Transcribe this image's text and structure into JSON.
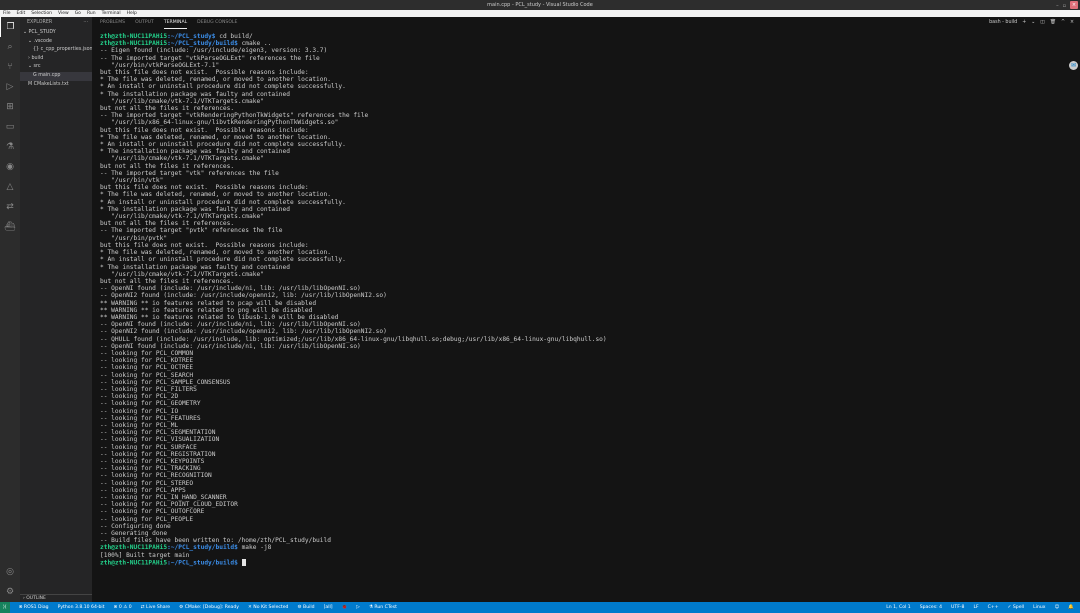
{
  "window": {
    "title": "main.cpp - PCL_study - Visual Studio Code",
    "min": "–",
    "max": "▫",
    "close": "×"
  },
  "menu": [
    "File",
    "Edit",
    "Selection",
    "View",
    "Go",
    "Run",
    "Terminal",
    "Help"
  ],
  "sidebar": {
    "title": "EXPLORER",
    "more": "···",
    "items": [
      {
        "label": "⌄ PCL_STUDY",
        "indent": 0
      },
      {
        "label": "⌄ .vscode",
        "indent": 1
      },
      {
        "label": "{} c_cpp_properties.json",
        "indent": 2
      },
      {
        "label": "› build",
        "indent": 1
      },
      {
        "label": "⌄ src",
        "indent": 1
      },
      {
        "label": "G main.cpp",
        "indent": 2,
        "selected": true
      },
      {
        "label": "M CMakeLists.txt",
        "indent": 1
      }
    ],
    "outline": "› OUTLINE"
  },
  "panel": {
    "tabs": [
      "PROBLEMS",
      "OUTPUT",
      "TERMINAL",
      "DEBUG CONSOLE"
    ],
    "active": 2,
    "controls": {
      "shell": "bash - build",
      "add": "+",
      "dropdown": "⌄",
      "split": "◫",
      "trash": "🗑",
      "maximize": "^",
      "close": "×"
    }
  },
  "terminal": {
    "user": "zth@zth-NUC11PAHi5",
    "lines": [
      {
        "path": ":~/PCL_study$",
        "cmd": " cd build/"
      },
      {
        "path": ":~/PCL_study/build$",
        "cmd": " cmake .."
      },
      "-- Eigen found (include: /usr/include/eigen3, version: 3.3.7)",
      "-- The imported target \"vtkParseOGLExt\" references the file",
      "   \"/usr/bin/vtkParseOGLExt-7.1\"",
      "but this file does not exist.  Possible reasons include:",
      "* The file was deleted, renamed, or moved to another location.",
      "* An install or uninstall procedure did not complete successfully.",
      "* The installation package was faulty and contained",
      "   \"/usr/lib/cmake/vtk-7.1/VTKTargets.cmake\"",
      "but not all the files it references.",
      "",
      "-- The imported target \"vtkRenderingPythonTkWidgets\" references the file",
      "   \"/usr/lib/x86_64-linux-gnu/libvtkRenderingPythonTkWidgets.so\"",
      "but this file does not exist.  Possible reasons include:",
      "* The file was deleted, renamed, or moved to another location.",
      "* An install or uninstall procedure did not complete successfully.",
      "* The installation package was faulty and contained",
      "   \"/usr/lib/cmake/vtk-7.1/VTKTargets.cmake\"",
      "but not all the files it references.",
      "",
      "-- The imported target \"vtk\" references the file",
      "   \"/usr/bin/vtk\"",
      "but this file does not exist.  Possible reasons include:",
      "* The file was deleted, renamed, or moved to another location.",
      "* An install or uninstall procedure did not complete successfully.",
      "* The installation package was faulty and contained",
      "   \"/usr/lib/cmake/vtk-7.1/VTKTargets.cmake\"",
      "but not all the files it references.",
      "",
      "-- The imported target \"pvtk\" references the file",
      "   \"/usr/bin/pvtk\"",
      "but this file does not exist.  Possible reasons include:",
      "* The file was deleted, renamed, or moved to another location.",
      "* An install or uninstall procedure did not complete successfully.",
      "* The installation package was faulty and contained",
      "   \"/usr/lib/cmake/vtk-7.1/VTKTargets.cmake\"",
      "but not all the files it references.",
      "",
      "-- OpenNI found (include: /usr/include/ni, lib: /usr/lib/libOpenNI.so)",
      "-- OpenNI2 found (include: /usr/include/openni2, lib: /usr/lib/libOpenNI2.so)",
      "** WARNING ** io features related to pcap will be disabled",
      "** WARNING ** io features related to png will be disabled",
      "** WARNING ** io features related to libusb-1.0 will be disabled",
      "-- OpenNI found (include: /usr/include/ni, lib: /usr/lib/libOpenNI.so)",
      "-- OpenNI2 found (include: /usr/include/openni2, lib: /usr/lib/libOpenNI2.so)",
      "-- QHULL found (include: /usr/include, lib: optimized;/usr/lib/x86_64-linux-gnu/libqhull.so;debug;/usr/lib/x86_64-linux-gnu/libqhull.so)",
      "-- OpenNI found (include: /usr/include/ni, lib: /usr/lib/libOpenNI.so)",
      "-- looking for PCL_COMMON",
      "-- looking for PCL_KDTREE",
      "-- looking for PCL_OCTREE",
      "-- looking for PCL_SEARCH",
      "-- looking for PCL_SAMPLE_CONSENSUS",
      "-- looking for PCL_FILTERS",
      "-- looking for PCL_2D",
      "-- looking for PCL_GEOMETRY",
      "-- looking for PCL_IO",
      "-- looking for PCL_FEATURES",
      "-- looking for PCL_ML",
      "-- looking for PCL_SEGMENTATION",
      "-- looking for PCL_VISUALIZATION",
      "-- looking for PCL_SURFACE",
      "-- looking for PCL_REGISTRATION",
      "-- looking for PCL_KEYPOINTS",
      "-- looking for PCL_TRACKING",
      "-- looking for PCL_RECOGNITION",
      "-- looking for PCL_STEREO",
      "-- looking for PCL_APPS",
      "-- looking for PCL_IN_HAND_SCANNER",
      "-- looking for PCL_POINT_CLOUD_EDITOR",
      "-- looking for PCL_OUTOFCORE",
      "-- looking for PCL_PEOPLE",
      "-- Configuring done",
      "-- Generating done",
      "-- Build files have been written to: /home/zth/PCL_study/build",
      {
        "path": ":~/PCL_study/build$",
        "cmd": " make -j8"
      },
      "[100%] Built target main",
      {
        "path": ":~/PCL_study/build$",
        "cmd": " ",
        "cursor": true
      }
    ]
  },
  "status": {
    "left": [
      "⊗ ROS1 Diag",
      "Python 3.8.10 64-bit",
      "⊗ 0 ⚠ 0",
      "⇄ Live Share",
      "⚙ CMake: [Debug]: Ready",
      "✕ No Kit Selected",
      "⚙ Build",
      "[all]",
      "🐞",
      "▷",
      "⚗ Run CTest"
    ],
    "right": [
      "Ln 1, Col 1",
      "Spaces: 4",
      "UTF-8",
      "LF",
      "C++",
      "✓ Spell",
      "Linux",
      "☺",
      "🔔"
    ],
    "remote": "⟩⟨"
  }
}
